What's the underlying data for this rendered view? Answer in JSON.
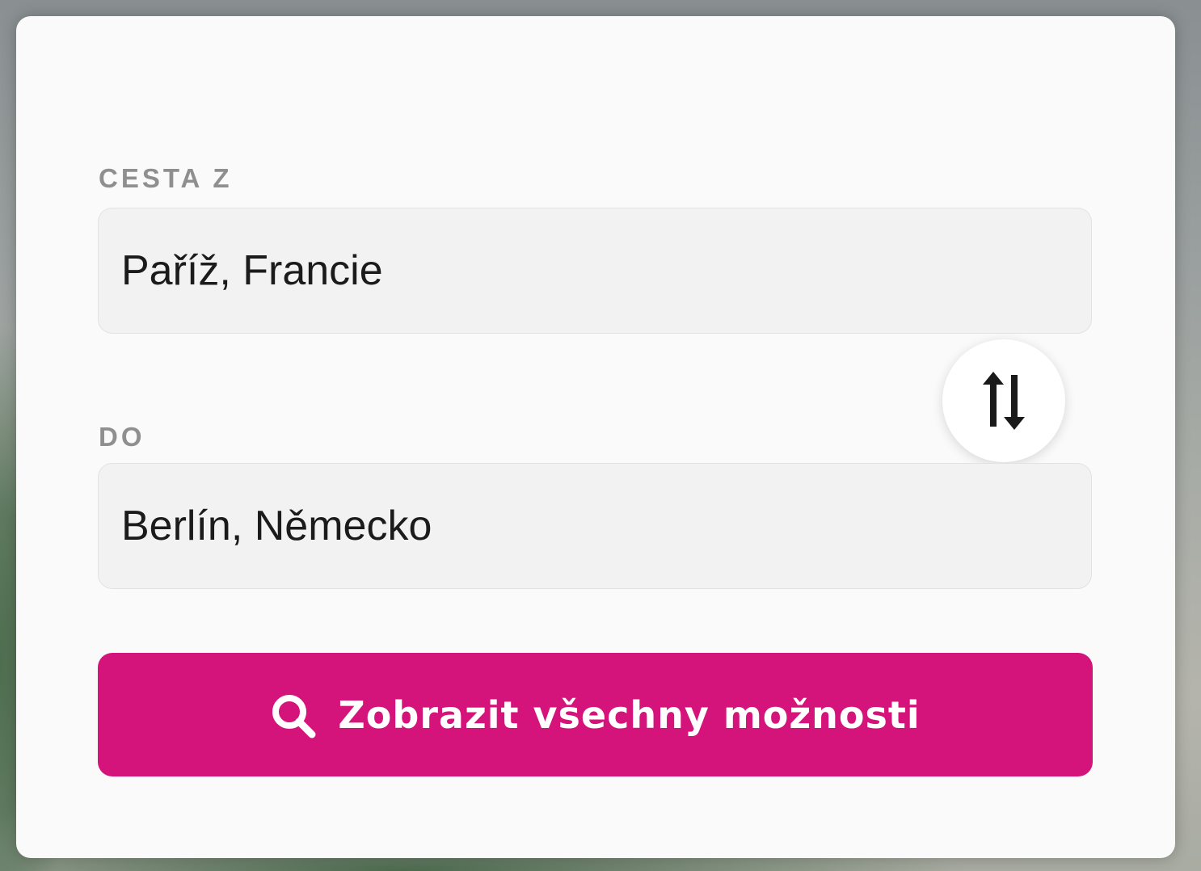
{
  "form": {
    "from": {
      "label": "CESTA Z",
      "value": "Paříž, Francie"
    },
    "to": {
      "label": "DO",
      "value": "Berlín, Německo"
    },
    "swap_icon": "swap-vertical-arrows-icon",
    "search_button": {
      "label": "Zobrazit všechny možnosti",
      "icon": "search-icon"
    }
  },
  "colors": {
    "accent": "#d4147a",
    "card_background": "#fafafa",
    "input_background": "#f2f2f2",
    "label_text": "#8f8f8f",
    "input_text": "#1b1b1b"
  }
}
